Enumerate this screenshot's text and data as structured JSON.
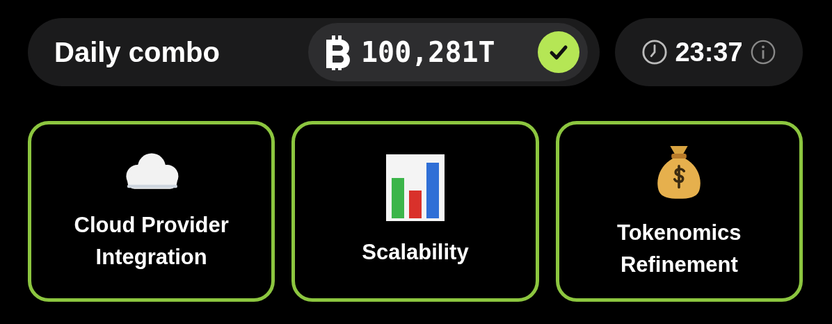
{
  "header": {
    "title": "Daily combo",
    "reward": "100,281T",
    "claimed": true,
    "timer": "23:37"
  },
  "cards": [
    {
      "kind": "cloud",
      "title": "Cloud Provider Integration",
      "found": true
    },
    {
      "kind": "chart",
      "title": "Scalability",
      "found": true
    },
    {
      "kind": "moneybag",
      "title": "Tokenomics Refinement",
      "found": true
    }
  ]
}
